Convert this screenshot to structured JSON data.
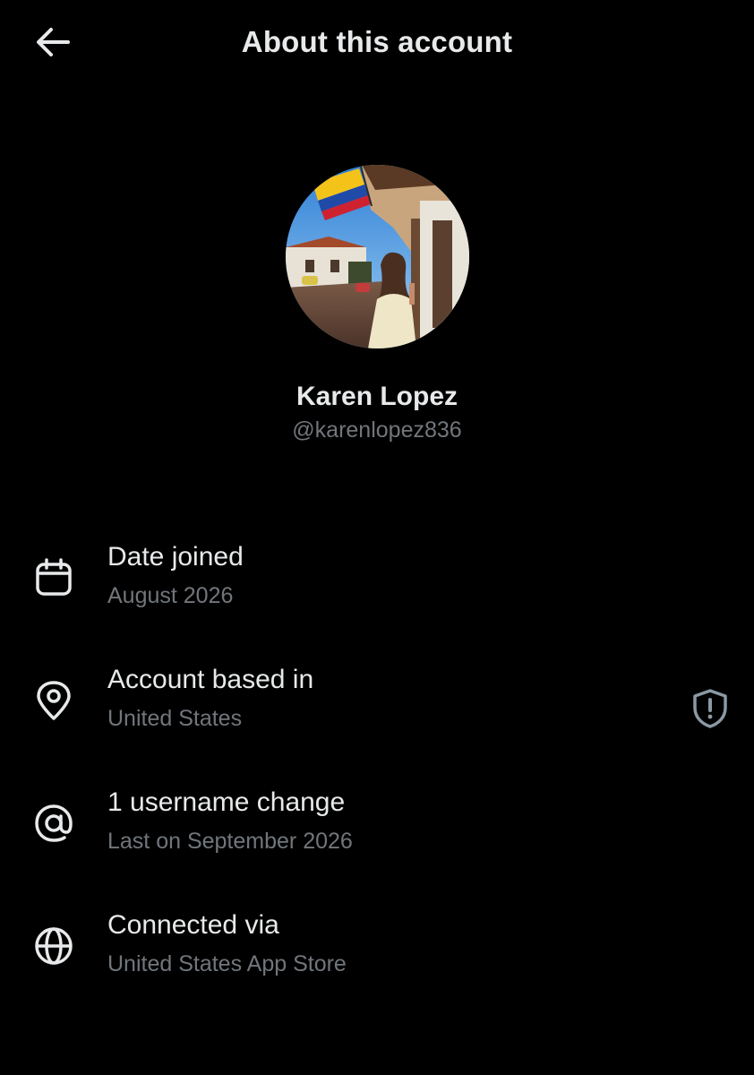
{
  "header": {
    "title": "About this account",
    "back_icon": "arrow-left-icon"
  },
  "profile": {
    "display_name": "Karen Lopez",
    "handle": "@karenlopez836",
    "avatar_description": "profile-photo"
  },
  "details": [
    {
      "icon": "calendar-icon",
      "title": "Date joined",
      "subtitle": "August 2026"
    },
    {
      "icon": "location-pin-icon",
      "title": "Account based in",
      "subtitle": "United States",
      "action_icon": "shield-alert-icon"
    },
    {
      "icon": "at-sign-icon",
      "title": "1 username change",
      "subtitle": "Last on September 2026"
    },
    {
      "icon": "globe-icon",
      "title": "Connected via",
      "subtitle": "United States App Store"
    }
  ],
  "colors": {
    "background": "#000000",
    "primary_text": "#e7e9ea",
    "secondary_text": "#71767b"
  }
}
